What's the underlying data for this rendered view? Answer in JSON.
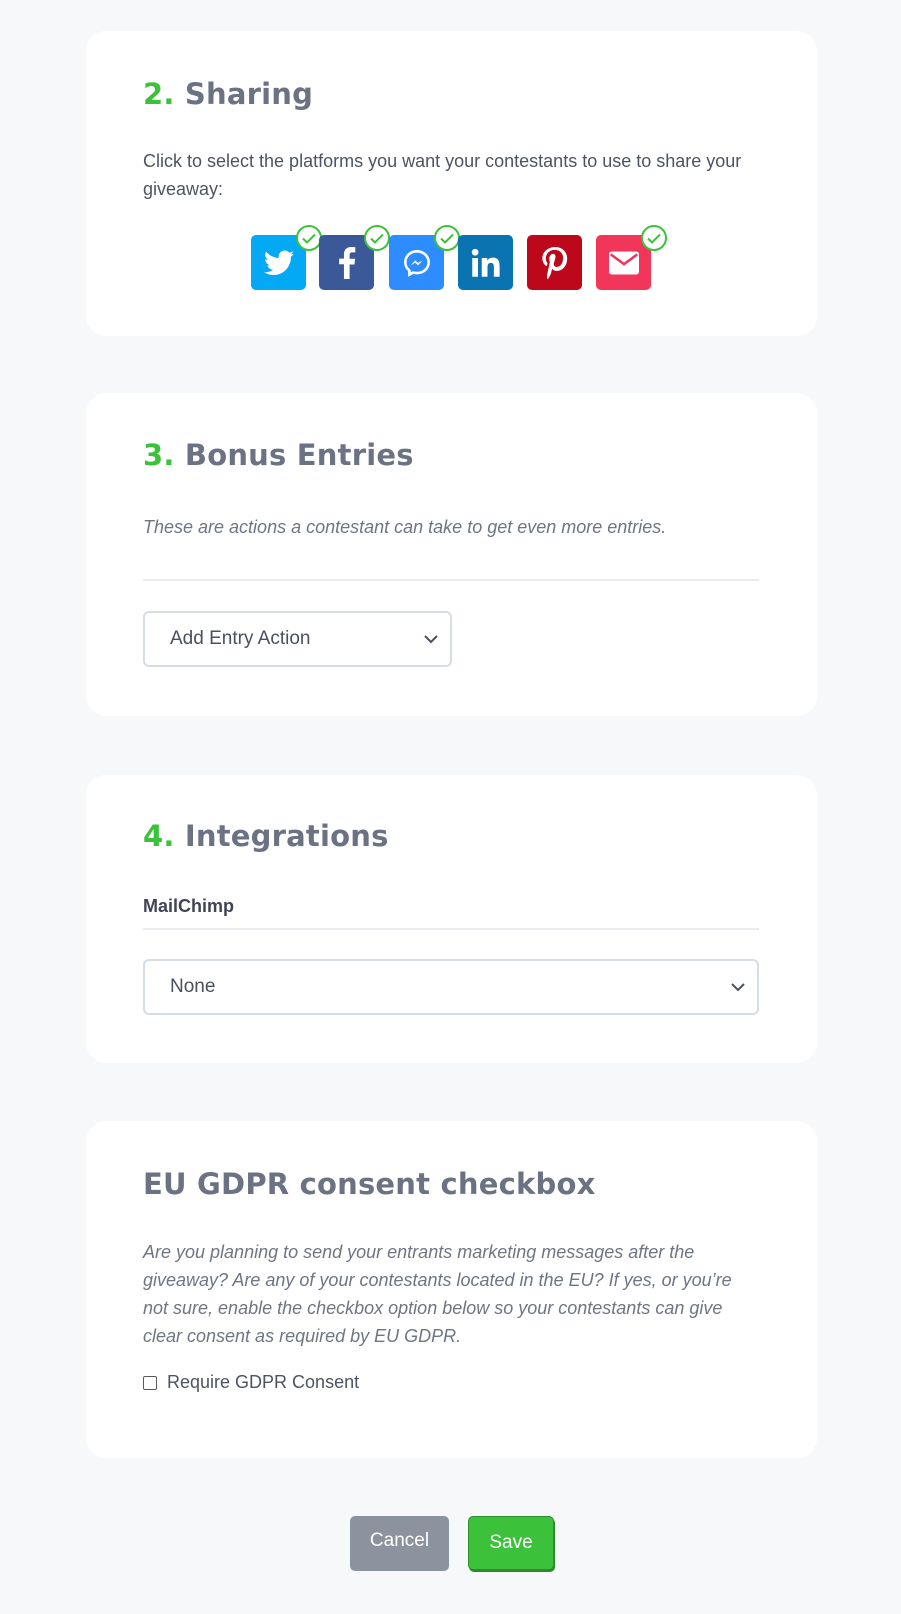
{
  "sharing": {
    "number": "2.",
    "title": "Sharing",
    "description": "Click to select the platforms you want your contestants to use to share your giveaway:",
    "platforms": [
      {
        "icon": "twitter-icon",
        "color": "#03a9f4",
        "selected": true
      },
      {
        "icon": "facebook-icon",
        "color": "#3b5998",
        "selected": true
      },
      {
        "icon": "messenger-icon",
        "color": "#2d8cff",
        "selected": true
      },
      {
        "icon": "linkedin-icon",
        "color": "#0a73b1",
        "selected": false
      },
      {
        "icon": "pinterest-icon",
        "color": "#bd081c",
        "selected": false
      },
      {
        "icon": "email-icon",
        "color": "#f1365a",
        "selected": true
      }
    ]
  },
  "bonus": {
    "number": "3.",
    "title": "Bonus Entries",
    "description": "These are actions a contestant can take to get even more entries.",
    "select_value": "Add Entry Action"
  },
  "integrations": {
    "number": "4.",
    "title": "Integrations",
    "mailchimp_label": "MailChimp",
    "select_value": "None"
  },
  "gdpr": {
    "title": "EU GDPR consent checkbox",
    "description": "Are you planning to send your entrants marketing messages after the giveaway? Are any of your contestants located in the EU? If yes, or you’re not sure, enable the checkbox option below so your contestants can give clear consent as required by EU GDPR.",
    "checkbox_label": "Require GDPR Consent",
    "checked": false
  },
  "actions": {
    "cancel_label": "Cancel",
    "save_label": "Save"
  },
  "colors": {
    "accent": "#3cc13b",
    "heading": "#6b7283",
    "cancel": "#8d939e"
  }
}
